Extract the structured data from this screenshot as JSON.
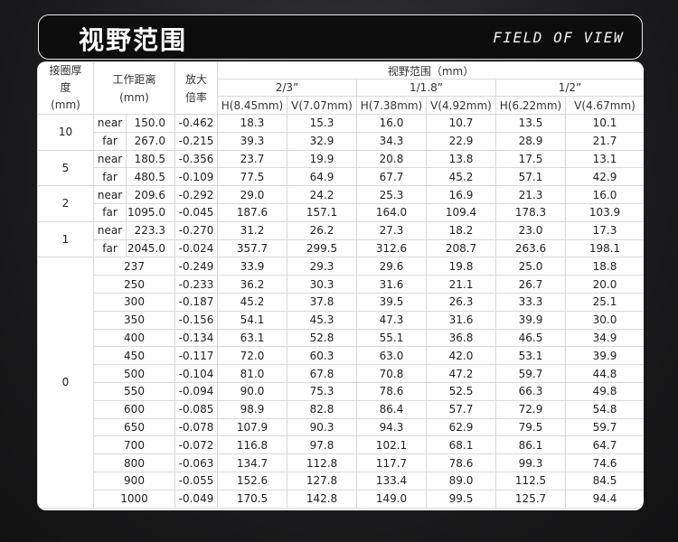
{
  "title": {
    "zh": "视野范围",
    "en": "FIELD OF VIEW"
  },
  "table": {
    "headers": {
      "ring_thickness": "接圈厚度(mm)",
      "working_distance": "工作距离(mm)",
      "magnification": "放大倍率",
      "fov": "视野范围（mm）",
      "sensors": [
        "2/3”",
        "1/1.8”",
        "1/2”"
      ],
      "columns": [
        "H(8.45mm)",
        "V(7.07mm)",
        "H(7.38mm)",
        "V(4.92mm)",
        "H(6.22mm)",
        "V(4.67mm)"
      ]
    },
    "groups": [
      {
        "ring": "10",
        "rows": [
          {
            "label": "near",
            "distance": "150.0",
            "mag": "-0.462",
            "vals": [
              "18.3",
              "15.3",
              "16.0",
              "10.7",
              "13.5",
              "10.1"
            ]
          },
          {
            "label": "far",
            "distance": "267.0",
            "mag": "-0.215",
            "vals": [
              "39.3",
              "32.9",
              "34.3",
              "22.9",
              "28.9",
              "21.7"
            ]
          }
        ]
      },
      {
        "ring": "5",
        "rows": [
          {
            "label": "near",
            "distance": "180.5",
            "mag": "-0.356",
            "vals": [
              "23.7",
              "19.9",
              "20.8",
              "13.8",
              "17.5",
              "13.1"
            ]
          },
          {
            "label": "far",
            "distance": "480.5",
            "mag": "-0.109",
            "vals": [
              "77.5",
              "64.9",
              "67.7",
              "45.2",
              "57.1",
              "42.9"
            ]
          }
        ]
      },
      {
        "ring": "2",
        "rows": [
          {
            "label": "near",
            "distance": "209.6",
            "mag": "-0.292",
            "vals": [
              "29.0",
              "24.2",
              "25.3",
              "16.9",
              "21.3",
              "16.0"
            ]
          },
          {
            "label": "far",
            "distance": "1095.0",
            "mag": "-0.045",
            "vals": [
              "187.6",
              "157.1",
              "164.0",
              "109.4",
              "178.3",
              "103.9"
            ]
          }
        ]
      },
      {
        "ring": "1",
        "rows": [
          {
            "label": "near",
            "distance": "223.3",
            "mag": "-0.270",
            "vals": [
              "31.2",
              "26.2",
              "27.3",
              "18.2",
              "23.0",
              "17.3"
            ]
          },
          {
            "label": "far",
            "distance": "2045.0",
            "mag": "-0.024",
            "vals": [
              "357.7",
              "299.5",
              "312.6",
              "208.7",
              "263.6",
              "198.1"
            ]
          }
        ]
      },
      {
        "ring": "0",
        "rows": [
          {
            "label": "",
            "distance": "237",
            "mag": "-0.249",
            "vals": [
              "33.9",
              "29.3",
              "29.6",
              "19.8",
              "25.0",
              "18.8"
            ]
          },
          {
            "label": "",
            "distance": "250",
            "mag": "-0.233",
            "vals": [
              "36.2",
              "30.3",
              "31.6",
              "21.1",
              "26.7",
              "20.0"
            ]
          },
          {
            "label": "",
            "distance": "300",
            "mag": "-0.187",
            "vals": [
              "45.2",
              "37.8",
              "39.5",
              "26.3",
              "33.3",
              "25.1"
            ]
          },
          {
            "label": "",
            "distance": "350",
            "mag": "-0.156",
            "vals": [
              "54.1",
              "45.3",
              "47.3",
              "31.6",
              "39.9",
              "30.0"
            ]
          },
          {
            "label": "",
            "distance": "400",
            "mag": "-0.134",
            "vals": [
              "63.1",
              "52.8",
              "55.1",
              "36.8",
              "46.5",
              "34.9"
            ]
          },
          {
            "label": "",
            "distance": "450",
            "mag": "-0.117",
            "vals": [
              "72.0",
              "60.3",
              "63.0",
              "42.0",
              "53.1",
              "39.9"
            ]
          },
          {
            "label": "",
            "distance": "500",
            "mag": "-0.104",
            "vals": [
              "81.0",
              "67.8",
              "70.8",
              "47.2",
              "59.7",
              "44.8"
            ]
          },
          {
            "label": "",
            "distance": "550",
            "mag": "-0.094",
            "vals": [
              "90.0",
              "75.3",
              "78.6",
              "52.5",
              "66.3",
              "49.8"
            ]
          },
          {
            "label": "",
            "distance": "600",
            "mag": "-0.085",
            "vals": [
              "98.9",
              "82.8",
              "86.4",
              "57.7",
              "72.9",
              "54.8"
            ]
          },
          {
            "label": "",
            "distance": "650",
            "mag": "-0.078",
            "vals": [
              "107.9",
              "90.3",
              "94.3",
              "62.9",
              "79.5",
              "59.7"
            ]
          },
          {
            "label": "",
            "distance": "700",
            "mag": "-0.072",
            "vals": [
              "116.8",
              "97.8",
              "102.1",
              "68.1",
              "86.1",
              "64.7"
            ]
          },
          {
            "label": "",
            "distance": "800",
            "mag": "-0.063",
            "vals": [
              "134.7",
              "112.8",
              "117.7",
              "78.6",
              "99.3",
              "74.6"
            ]
          },
          {
            "label": "",
            "distance": "900",
            "mag": "-0.055",
            "vals": [
              "152.6",
              "127.8",
              "133.4",
              "89.0",
              "112.5",
              "84.5"
            ]
          },
          {
            "label": "",
            "distance": "1000",
            "mag": "-0.049",
            "vals": [
              "170.5",
              "142.8",
              "149.0",
              "99.5",
              "125.7",
              "94.4"
            ]
          }
        ]
      }
    ]
  }
}
